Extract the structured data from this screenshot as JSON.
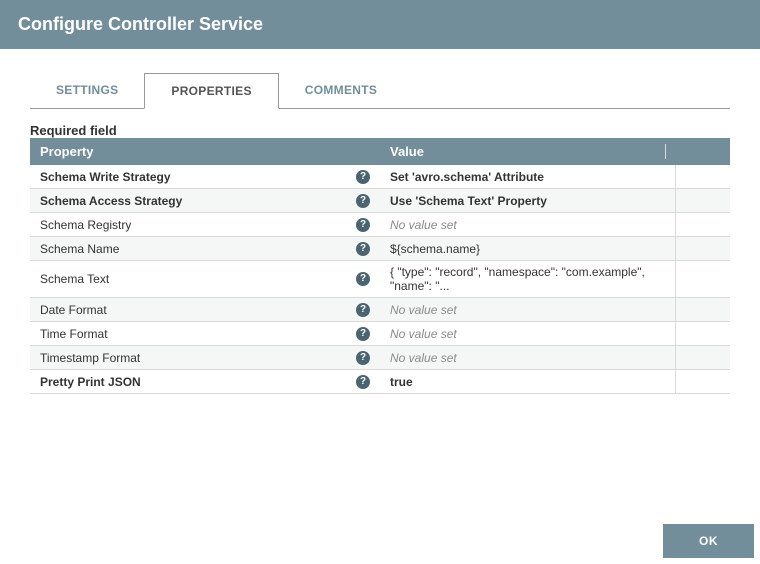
{
  "dialog": {
    "title": "Configure Controller Service"
  },
  "tabs": {
    "settings": "SETTINGS",
    "properties": "PROPERTIES",
    "comments": "COMMENTS"
  },
  "required_label": "Required field",
  "table": {
    "header_property": "Property",
    "header_value": "Value",
    "no_value": "No value set",
    "rows": [
      {
        "name": "Schema Write Strategy",
        "value": "Set 'avro.schema' Attribute",
        "bold": true
      },
      {
        "name": "Schema Access Strategy",
        "value": "Use 'Schema Text' Property",
        "bold": true
      },
      {
        "name": "Schema Registry",
        "value": "",
        "bold": false
      },
      {
        "name": "Schema Name",
        "value": "${schema.name}",
        "bold": false
      },
      {
        "name": "Schema Text",
        "value": "{ \"type\": \"record\", \"namespace\": \"com.example\", \"name\": \"...",
        "bold": false
      },
      {
        "name": "Date Format",
        "value": "",
        "bold": false
      },
      {
        "name": "Time Format",
        "value": "",
        "bold": false
      },
      {
        "name": "Timestamp Format",
        "value": "",
        "bold": false
      },
      {
        "name": "Pretty Print JSON",
        "value": "true",
        "bold": true
      }
    ]
  },
  "buttons": {
    "ok": "OK"
  }
}
